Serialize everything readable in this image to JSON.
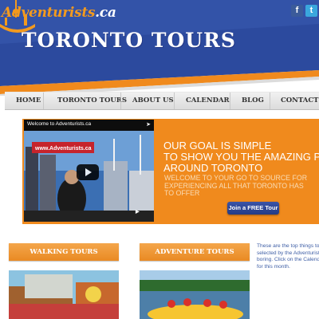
{
  "header": {
    "logo_main": "Adventurists",
    "logo_ca": ".ca",
    "site_title": "TORONTO TOURS",
    "social": [
      {
        "name": "facebook",
        "glyph": "f"
      },
      {
        "name": "twitter",
        "glyph": "t"
      }
    ]
  },
  "nav": {
    "items": [
      {
        "label": "HOME"
      },
      {
        "label": "TORONTO TOURS"
      },
      {
        "label": "ABOUT US"
      },
      {
        "label": "CALENDAR"
      },
      {
        "label": "BLOG"
      },
      {
        "label": "CONTACT"
      }
    ]
  },
  "hero": {
    "video_title": "Welcome to Adventurists.ca",
    "video_sign": "www.Adventurists.ca",
    "headline_lines": [
      "OUR GOAL IS SIMPLE",
      "TO SHOW YOU THE AMAZING P",
      "AROUND TORONTO"
    ],
    "sub_lines": [
      "WELCOME TO YOUR GO TO SOURCE FOR",
      "EXPERIENCING ALL THAT TORONTO HAS",
      "TO OFFER"
    ],
    "cta_label": "Join a FREE Tour"
  },
  "tours": [
    {
      "label": "WALKING TOURS"
    },
    {
      "label": "ADVENTURE TOURS"
    }
  ],
  "side_text": {
    "lines": [
      "These are the top things to",
      "selected by the Adventurist",
      "boring. Click on the Calend",
      "for this month."
    ]
  },
  "colors": {
    "brand_blue": "#2f4b9c",
    "brand_orange": "#f08a1d",
    "link_blue": "#3f5fa6"
  },
  "icons": {
    "toronto_skyline": "cn-tower-icon",
    "share": "share-icon",
    "play": "play-icon"
  }
}
